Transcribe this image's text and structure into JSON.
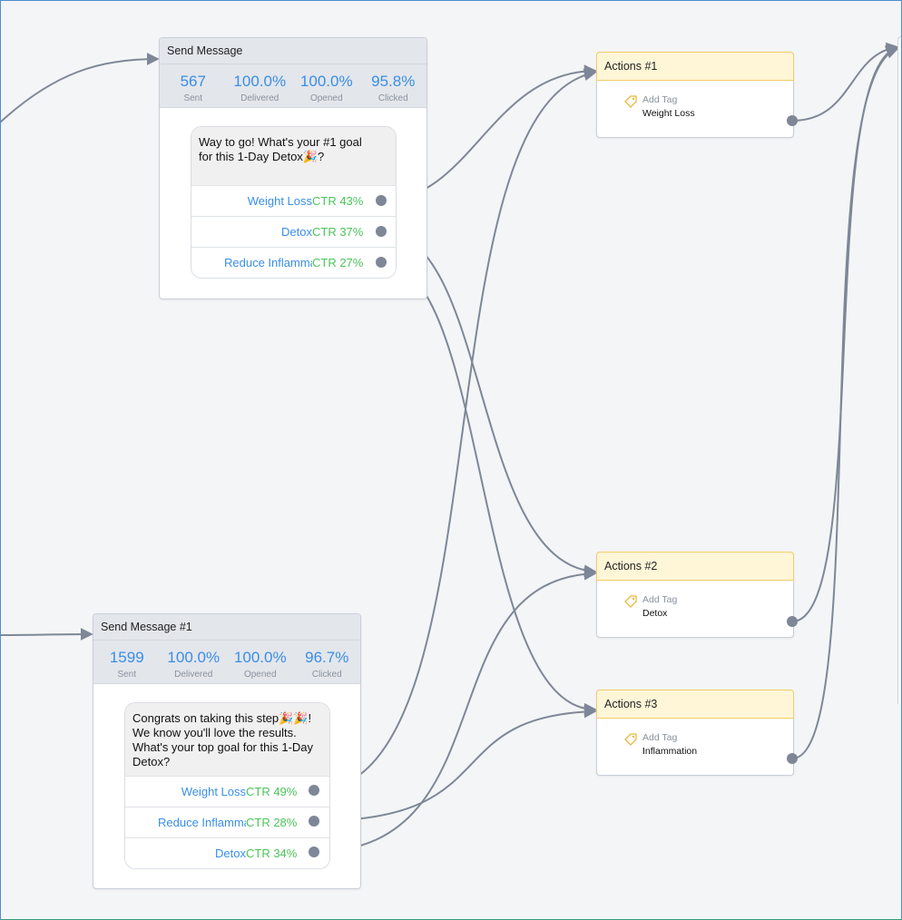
{
  "msg1": {
    "title": "Send Message",
    "stats": [
      {
        "value": "567",
        "label": "Sent"
      },
      {
        "value": "100.0%",
        "label": "Delivered"
      },
      {
        "value": "100.0%",
        "label": "Opened"
      },
      {
        "value": "95.8%",
        "label": "Clicked"
      }
    ],
    "text": "Way to go! What's your #1  goal for this 1-Day Detox🎉?",
    "buttons": [
      {
        "label": "Weight Loss",
        "ctr": "CTR 43%"
      },
      {
        "label": "Detox",
        "ctr": "CTR 37%"
      },
      {
        "label": "Reduce Inflammation",
        "ctr": "CTR 27%"
      }
    ]
  },
  "msg2": {
    "title": "Send Message #1",
    "stats": [
      {
        "value": "1599",
        "label": "Sent"
      },
      {
        "value": "100.0%",
        "label": "Delivered"
      },
      {
        "value": "100.0%",
        "label": "Opened"
      },
      {
        "value": "96.7%",
        "label": "Clicked"
      }
    ],
    "text": "Congrats on taking this step🎉🎉! We know you'll love the results. What's your top goal for this 1-Day Detox?",
    "buttons": [
      {
        "label": "Weight Loss",
        "ctr": "CTR 49%"
      },
      {
        "label": "Reduce Inflammation",
        "ctr": "CTR 28%"
      },
      {
        "label": "Detox",
        "ctr": "CTR 34%"
      }
    ]
  },
  "actions": [
    {
      "title": "Actions #1",
      "tag_title": "Add Tag",
      "tag": "Weight Loss"
    },
    {
      "title": "Actions #2",
      "tag_title": "Add Tag",
      "tag": "Detox"
    },
    {
      "title": "Actions #3",
      "tag_title": "Add Tag",
      "tag": "Inflammation"
    }
  ],
  "colors": {
    "accent": "#3a8ee6",
    "ctr": "#4cc45a",
    "action_header": "#fff6d8",
    "action_border": "#f2cd6a",
    "wire": "#7e8797"
  }
}
